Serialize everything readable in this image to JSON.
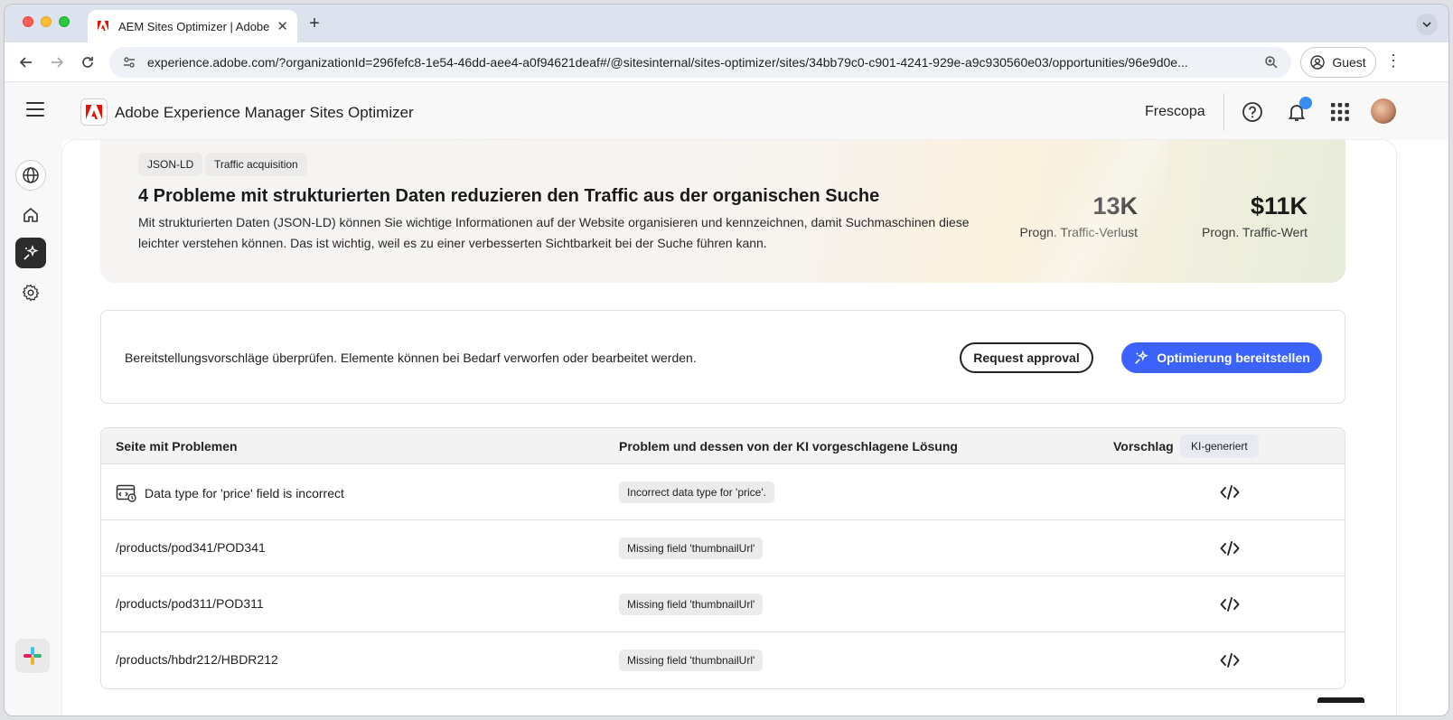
{
  "browser": {
    "tab_title": "AEM Sites Optimizer | Adobe",
    "url": "experience.adobe.com/?organizationId=296fefc8-1e54-46dd-aee4-a0f94621deaf#/@sitesinternal/sites-optimizer/sites/34bb79c0-c901-4241-929e-a9c930560e03/opportunities/96e9d0e...",
    "guest_label": "Guest"
  },
  "app": {
    "title": "Adobe Experience Manager Sites Optimizer",
    "org": "Frescopa"
  },
  "opportunity": {
    "tags": [
      "JSON-LD",
      "Traffic acquisition"
    ],
    "title": "4 Probleme mit strukturierten Daten reduzieren den Traffic aus der organischen Suche",
    "description": "Mit strukturierten Daten (JSON-LD) können Sie wichtige Informationen auf der Website organisieren und kennzeichnen, damit Suchmaschinen diese leichter verstehen können. Das ist wichtig, weil es zu einer verbesserten Sichtbarkeit bei der Suche führen kann.",
    "metrics": [
      {
        "value": "13K",
        "label": "Progn. Traffic-Verlust"
      },
      {
        "value": "$11K",
        "label": "Progn. Traffic-Wert"
      }
    ]
  },
  "deploy": {
    "text": "Bereitstellungsvorschläge überprüfen. Elemente können bei Bedarf verworfen oder bearbeitet werden.",
    "request_label": "Request approval",
    "deploy_label": "Optimierung bereitstellen"
  },
  "table": {
    "headers": {
      "page": "Seite mit Problemen",
      "issue": "Problem und dessen von der KI vorgeschlagene Lösung",
      "suggestion": "Vorschlag",
      "ai_badge": "KI-generiert"
    },
    "rows": [
      {
        "page": "Data type for 'price' field is incorrect",
        "issue": "Incorrect data type for 'price'."
      },
      {
        "page": "/products/pod341/POD341",
        "issue": "Missing field 'thumbnailUrl'"
      },
      {
        "page": "/products/pod311/POD311",
        "issue": "Missing field 'thumbnailUrl'"
      },
      {
        "page": "/products/hbdr212/HBDR212",
        "issue": "Missing field 'thumbnailUrl'"
      }
    ]
  },
  "colors": {
    "primary_button": "#3b63fb",
    "adobe_red": "#eb1000",
    "notification": "#378ef0"
  }
}
